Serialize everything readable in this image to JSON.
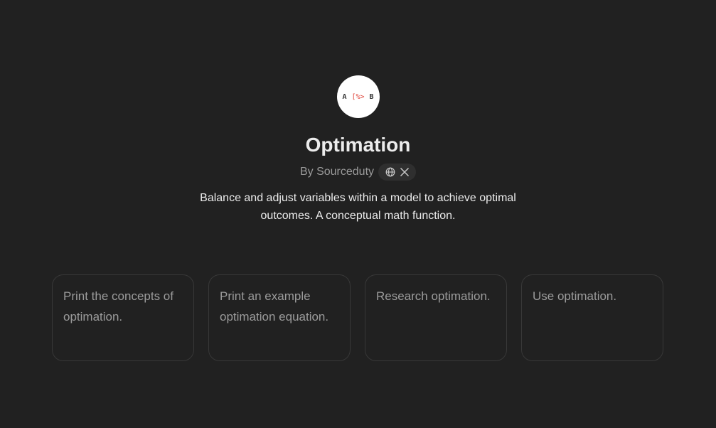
{
  "gpt": {
    "avatar": {
      "left": "A",
      "middle": "[%>",
      "right": "B"
    },
    "title": "Optimation",
    "byline": "By Sourceduty",
    "social_icons": [
      "globe-icon",
      "x-icon"
    ],
    "description": "Balance and adjust variables within a model to achieve optimal outcomes. A conceptual math function."
  },
  "starters": [
    {
      "label": "Print the concepts of optimation."
    },
    {
      "label": "Print an example optimation equation."
    },
    {
      "label": "Research optimation."
    },
    {
      "label": "Use optimation."
    }
  ],
  "colors": {
    "background": "#212121",
    "card_border": "#383838",
    "muted_text": "#9b9b9b",
    "accent": "#e0453b"
  }
}
